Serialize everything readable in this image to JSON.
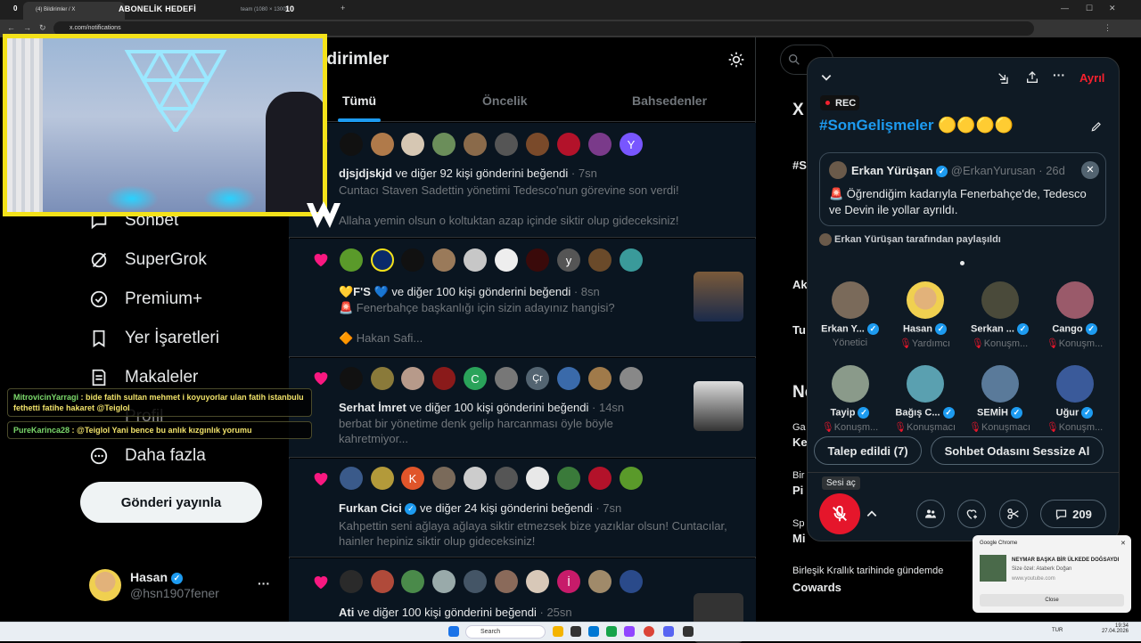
{
  "browser": {
    "tabs": [
      {
        "label": "(4) Bildirimler / X",
        "active": true
      },
      {
        "label": "team (1080 × 1300)",
        "active": false
      }
    ],
    "url": "x.com/notifications"
  },
  "stream": {
    "counter_left": "0",
    "sub_goal_label": "ABONELİK HEDEFİ",
    "sub_goal_value": "10",
    "chat": [
      {
        "user": "MitrovicinYarragi",
        "text": " : bide fatih sultan mehmet i koyuyorlar ulan fatih istanbulu fethetti fatihe hakaret @Teiglol"
      },
      {
        "user": "PureKarinca28",
        "text": " : @Teiglol Yani bence bu anlık kızgınlık yorumu"
      }
    ]
  },
  "nav": {
    "items": [
      {
        "label": "Sohbet",
        "icon": "chat-icon"
      },
      {
        "label": "SuperGrok",
        "icon": "grok-icon"
      },
      {
        "label": "Premium+",
        "icon": "premium-icon"
      },
      {
        "label": "Yer İşaretleri",
        "icon": "bookmark-icon"
      },
      {
        "label": "Makaleler",
        "icon": "article-icon"
      },
      {
        "label": "Profil",
        "icon": "profile-icon"
      },
      {
        "label": "Daha fazla",
        "icon": "more-icon"
      }
    ],
    "post_button": "Gönderi yayınla",
    "account": {
      "name": "Hasan",
      "handle": "@hsn1907fener",
      "more": "···"
    }
  },
  "notifications": {
    "title": "ildirimler",
    "tabs": [
      "Tümü",
      "Öncelik",
      "Bahsedenler"
    ],
    "items": [
      {
        "actor": "djsjdjskjd",
        "action": " ve diğer 92 kişi gönderini beğendi",
        "time": "· 7sn",
        "line1": "Cuntacı Staven Sadettin yönetimi Tedesco'nun görevine son verdi!",
        "line2": "Allaha yemin olsun o koltuktan azap içinde siktir olup gideceksiniz!"
      },
      {
        "actor": "💛F'S 💙",
        "action": " ve diğer 100 kişi gönderini beğendi",
        "time": "· 8sn",
        "line1": "🚨 Fenerbahçe başkanlığı için sizin adayınız hangisi?",
        "line2": "🔶 Hakan Safi..."
      },
      {
        "actor": "Serhat İmret",
        "action": " ve diğer 100 kişi gönderini beğendi",
        "time": "· 14sn",
        "line1": "berbat bir yönetime denk gelip harcanması öyle böyle",
        "line2": "kahretmiyor..."
      },
      {
        "actor": "Furkan Cici",
        "action": " ve diğer 24 kişi gönderini beğendi",
        "time": "· 7sn",
        "line1": "Kahpettin seni ağlaya ağlaya siktir etmezsek bize yazıklar olsun! Cuntacılar,",
        "line2": "hainler hepiniz siktir olup gideceksiniz!"
      },
      {
        "actor": "Ati",
        "action": " ve diğer 100 kişi gönderini beğendi",
        "time": "· 25sn",
        "line1": "",
        "line2": ""
      }
    ]
  },
  "rightcol": {
    "snippets": [
      "X",
      "#S",
      "Ak",
      "Tu",
      "No",
      "Ga",
      "Ke",
      "Bir",
      "Pi",
      "Sp",
      "Mi"
    ],
    "trend_context": "Birleşik Krallık tarihinde gündemde",
    "trend_name": "Cowards"
  },
  "space": {
    "leave": "Ayrıl",
    "rec": "REC",
    "title": "#SonGelişmeler 🟡🟡🟡🟡",
    "pinned": {
      "author": "Erkan Yürüşan",
      "handle": "@ErkanYurusan · 26d",
      "text": "🚨 Öğrendiğim kadarıyla Fenerbahçe'de, Tedesco ve Devin ile yollar ayrıldı.",
      "shared_by": "Erkan Yürüşan tarafından paylaşıldı"
    },
    "speakers": [
      {
        "name": "Erkan Y...",
        "role": "Yönetici"
      },
      {
        "name": "Hasan",
        "role": "Yardımcı"
      },
      {
        "name": "Serkan ...",
        "role": "Konuşm..."
      },
      {
        "name": "Cango",
        "role": "Konuşm..."
      },
      {
        "name": "Tayip",
        "role": "Konuşm..."
      },
      {
        "name": "Bağış C...",
        "role": "Konuşmacı"
      },
      {
        "name": "SEMİH",
        "role": "Konuşmacı"
      },
      {
        "name": "Uğur",
        "role": "Konuşm..."
      }
    ],
    "requests_button": "Talep edildi (7)",
    "mute_room_button": "Sohbet Odasını Sessize Al",
    "unmute_tooltip": "Sesi aç",
    "comment_count": "209"
  },
  "toast": {
    "app": "Google Chrome",
    "title": "NEYMAR BAŞKA BİR ÜLKEDE DOĞSAYDI",
    "line": "Size özel: Ataberk Doğan",
    "source": "www.youtube.com",
    "close": "Close"
  },
  "taskbar": {
    "search": "Search",
    "lang": "TUR",
    "time": "19:34",
    "date": "27.04.2026"
  },
  "colors": {
    "accent": "#1d9bf0",
    "like": "#f91880",
    "live_red": "#e5162b",
    "stream_yellow": "#f4e21a"
  }
}
